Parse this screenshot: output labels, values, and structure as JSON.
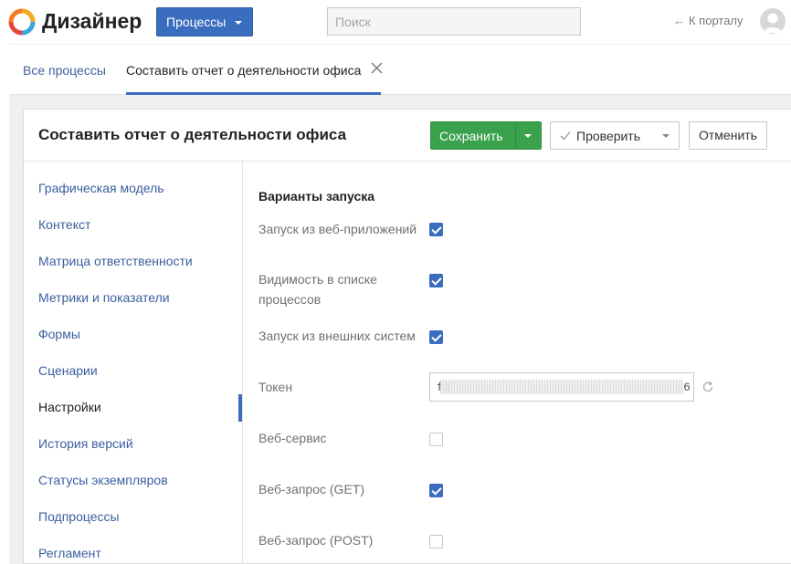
{
  "app": {
    "title": "Дизайнер"
  },
  "header": {
    "processes_button": "Процессы",
    "search_placeholder": "Поиск",
    "portal_arrow": "←",
    "portal_link": "К порталу"
  },
  "tabs": [
    {
      "label": "Все процессы",
      "active": false
    },
    {
      "label": "Составить отчет о деятельности офиса",
      "active": true
    }
  ],
  "card": {
    "title": "Составить отчет о деятельности офиса",
    "save_label": "Сохранить",
    "check_label": "Проверить",
    "cancel_label": "Отменить"
  },
  "nav": {
    "items": [
      {
        "label": "Графическая модель"
      },
      {
        "label": "Контекст"
      },
      {
        "label": "Матрица ответственности"
      },
      {
        "label": "Метрики и показатели"
      },
      {
        "label": "Формы"
      },
      {
        "label": "Сценарии"
      },
      {
        "label": "Настройки",
        "active": true
      },
      {
        "label": "История версий"
      },
      {
        "label": "Статусы экземпляров"
      },
      {
        "label": "Подпроцессы"
      },
      {
        "label": "Регламент"
      }
    ]
  },
  "settings": {
    "section_title": "Варианты запуска",
    "rows": [
      {
        "label": "Запуск из веб-приложений",
        "checked": true
      },
      {
        "label": "Видимость в списке процессов",
        "checked": true
      },
      {
        "label": "Запуск из внешних систем",
        "checked": true
      },
      {
        "label": "Токен"
      },
      {
        "label": "Веб-сервис",
        "checked": false
      },
      {
        "label": "Веб-запрос (GET)",
        "checked": true
      },
      {
        "label": "Веб-запрос (POST)",
        "checked": false
      }
    ],
    "token_value": "f4                                   6"
  },
  "colors": {
    "primary": "#3b6dbf",
    "success": "#3aa14d",
    "link": "#3b5f9e",
    "background": "#eef0f2"
  },
  "icons": {
    "logo": "elma-logo-icon",
    "avatar": "user-avatar-icon",
    "close": "close-icon",
    "check": "checkmark-icon",
    "refresh": "refresh-icon"
  }
}
